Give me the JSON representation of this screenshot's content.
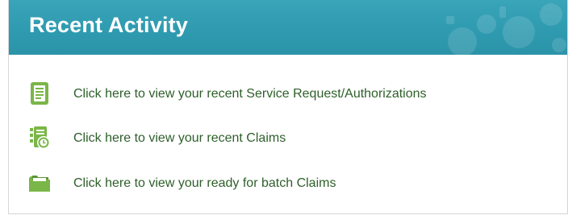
{
  "panel": {
    "title": "Recent Activity",
    "header_color": "#2f9bb0",
    "link_color": "#2e5f2a",
    "icon_color": "#7ab648"
  },
  "items": [
    {
      "label": "Click here to view your recent Service Request/Authorizations",
      "icon": "document-icon"
    },
    {
      "label": "Click here to view your recent Claims",
      "icon": "claims-clock-icon"
    },
    {
      "label": "Click here to view your ready for batch Claims",
      "icon": "folder-icon"
    }
  ]
}
